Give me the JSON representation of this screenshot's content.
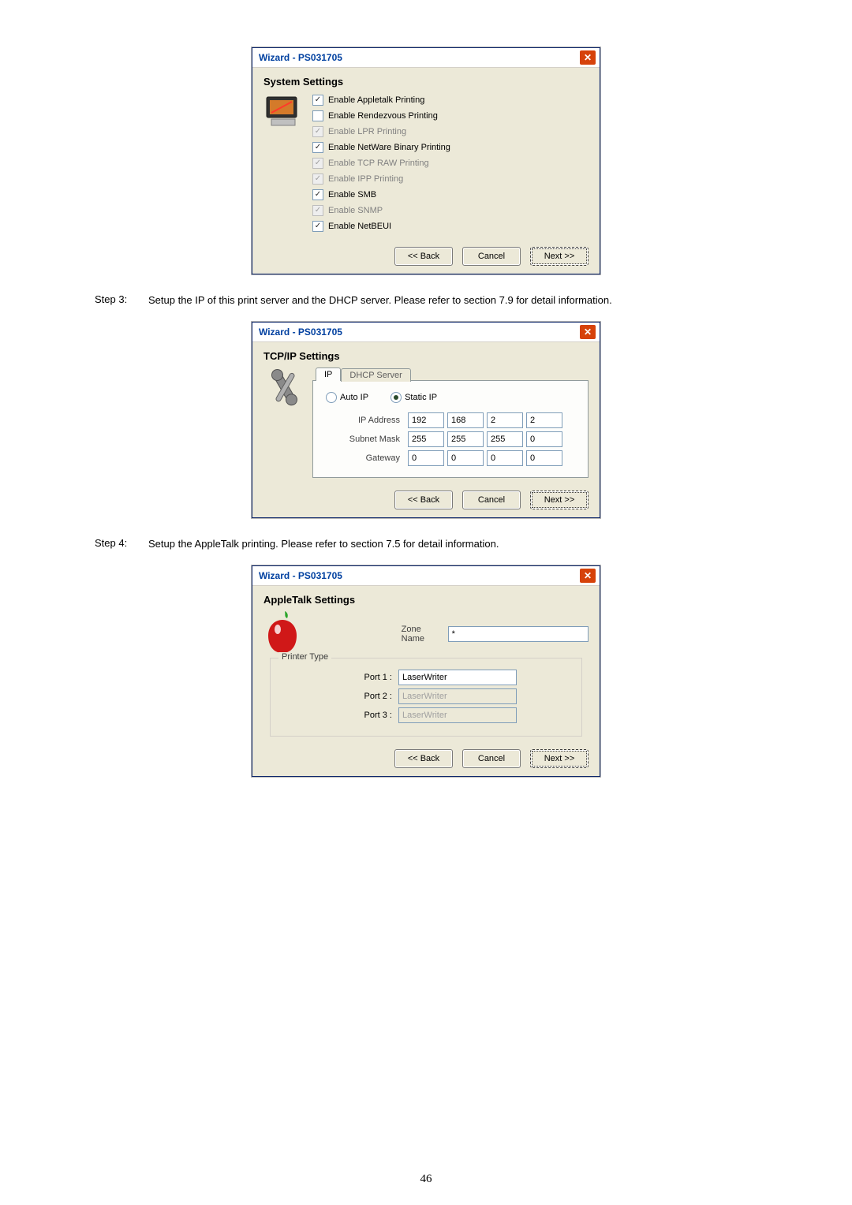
{
  "page_number": "46",
  "dialog1": {
    "title": "Wizard - PS031705",
    "section": "System Settings",
    "checks": [
      {
        "label": "Enable Appletalk Printing",
        "checked": true,
        "disabled": false
      },
      {
        "label": "Enable Rendezvous Printing",
        "checked": false,
        "disabled": false
      },
      {
        "label": "Enable LPR Printing",
        "checked": true,
        "disabled": true
      },
      {
        "label": "Enable NetWare Binary Printing",
        "checked": true,
        "disabled": false
      },
      {
        "label": "Enable TCP RAW Printing",
        "checked": true,
        "disabled": true
      },
      {
        "label": "Enable IPP Printing",
        "checked": true,
        "disabled": true
      },
      {
        "label": "Enable SMB",
        "checked": true,
        "disabled": false
      },
      {
        "label": "Enable SNMP",
        "checked": true,
        "disabled": true
      },
      {
        "label": "Enable NetBEUI",
        "checked": true,
        "disabled": false
      }
    ],
    "buttons": {
      "back": "<< Back",
      "cancel": "Cancel",
      "next": "Next >>"
    }
  },
  "step3": {
    "label": "Step 3:",
    "text": "Setup the IP of this print server and the DHCP server. Please refer to section 7.9 for detail information."
  },
  "dialog2": {
    "title": "Wizard - PS031705",
    "section": "TCP/IP Settings",
    "tabs": {
      "ip": "IP",
      "dhcp": "DHCP Server"
    },
    "radio": {
      "auto": "Auto IP",
      "static": "Static IP",
      "selected": "static"
    },
    "rows": {
      "ip_label": "IP Address",
      "ip": [
        "192",
        "168",
        "2",
        "2"
      ],
      "mask_label": "Subnet Mask",
      "mask": [
        "255",
        "255",
        "255",
        "0"
      ],
      "gw_label": "Gateway",
      "gw": [
        "0",
        "0",
        "0",
        "0"
      ]
    },
    "buttons": {
      "back": "<< Back",
      "cancel": "Cancel",
      "next": "Next >>"
    }
  },
  "step4": {
    "label": "Step 4:",
    "text": "Setup the AppleTalk printing. Please refer to section 7.5 for detail information."
  },
  "dialog3": {
    "title": "Wizard - PS031705",
    "section": "AppleTalk Settings",
    "zone_label": "Zone Name",
    "zone_value": "*",
    "fieldset_label": "Printer Type",
    "ports": [
      {
        "label": "Port 1 :",
        "value": "LaserWriter",
        "disabled": false
      },
      {
        "label": "Port 2 :",
        "value": "LaserWriter",
        "disabled": true
      },
      {
        "label": "Port 3 :",
        "value": "LaserWriter",
        "disabled": true
      }
    ],
    "buttons": {
      "back": "<< Back",
      "cancel": "Cancel",
      "next": "Next >>"
    }
  },
  "chart_data": null
}
